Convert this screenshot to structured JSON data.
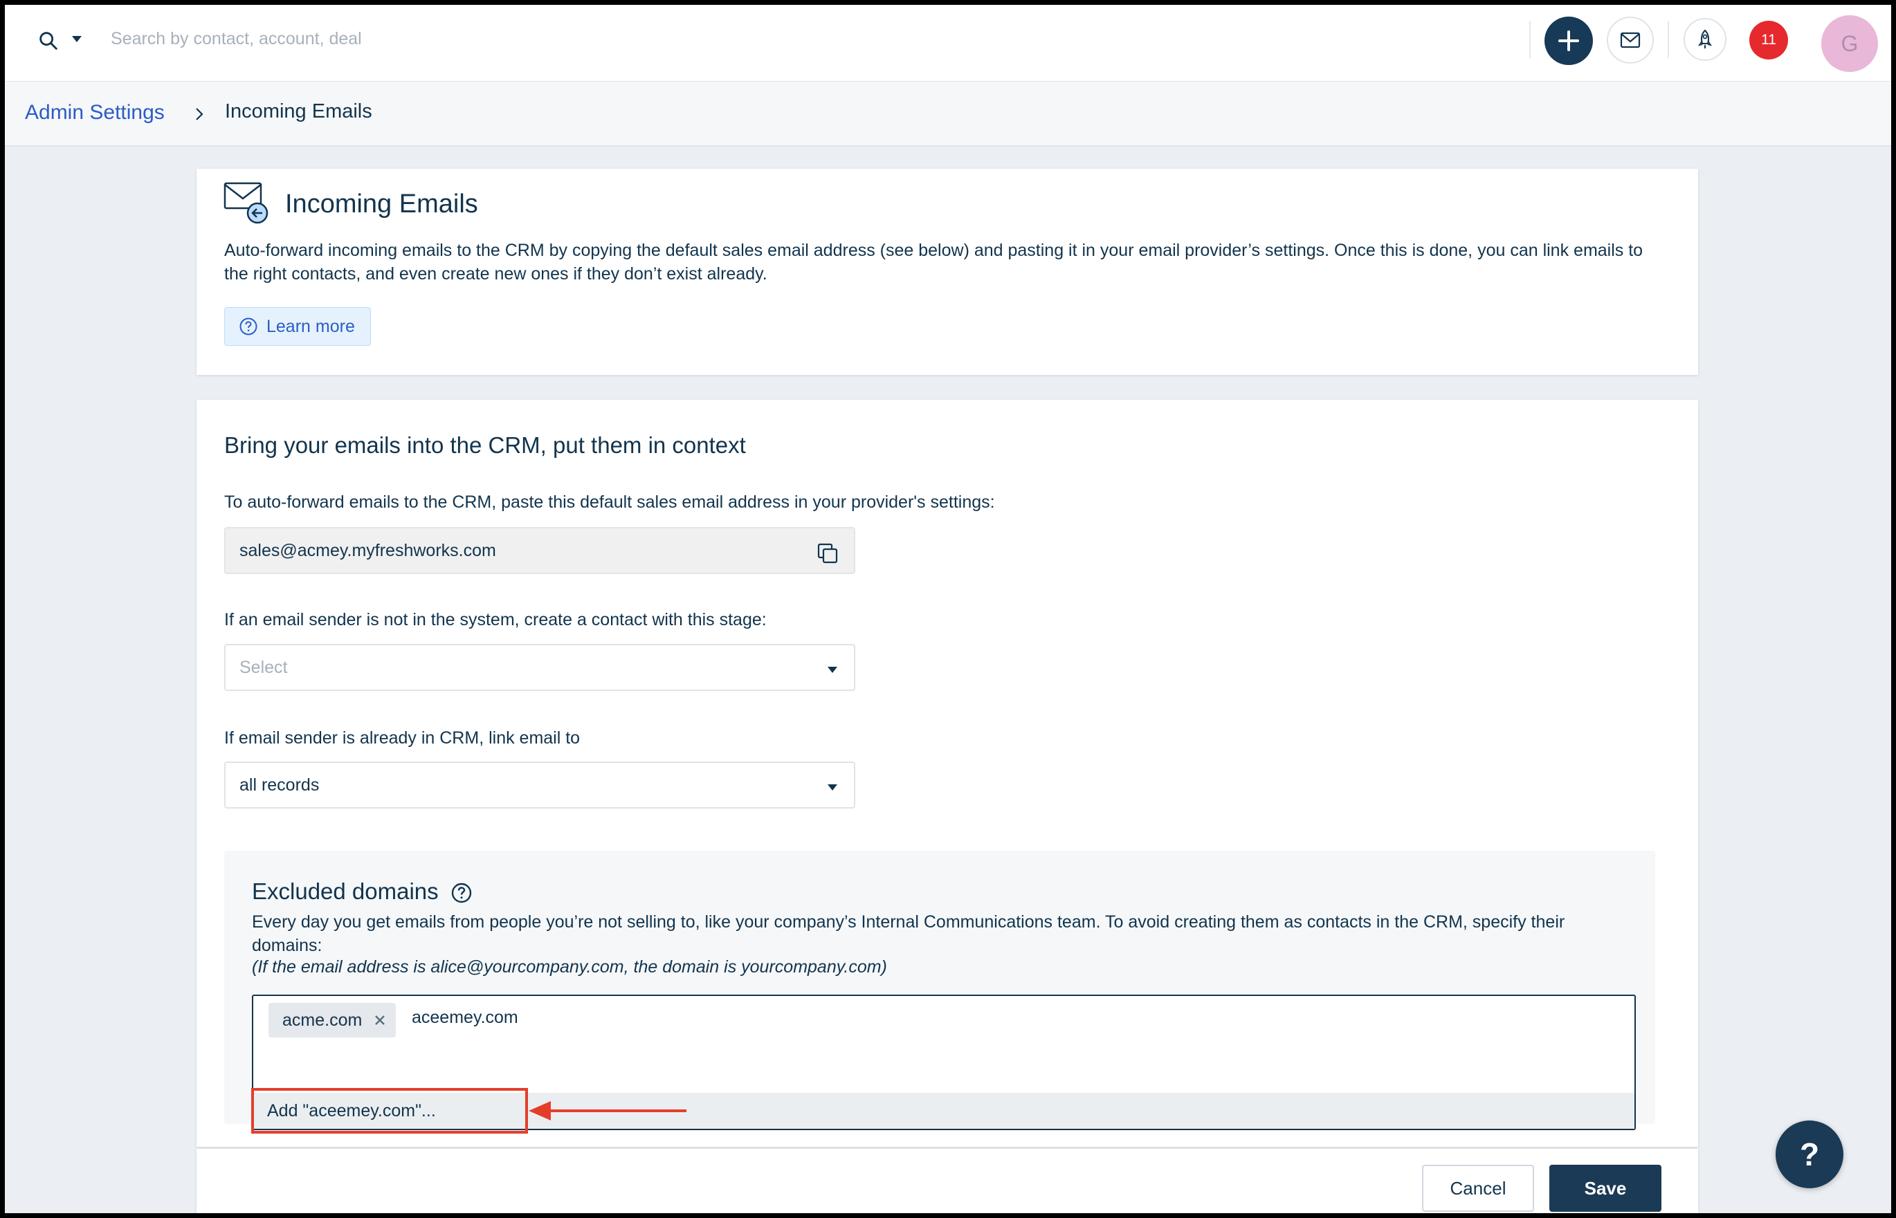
{
  "topbar": {
    "search_placeholder": "Search by contact, account, deal",
    "icons": [
      "search-icon",
      "chevron-down-icon",
      "plus-icon",
      "mail-icon",
      "rocket-icon"
    ],
    "notification_count": "11",
    "avatar_initial": "G"
  },
  "breadcrumb": {
    "parent": "Admin Settings",
    "current": "Incoming Emails"
  },
  "intro": {
    "title": "Incoming Emails",
    "description": "Auto-forward incoming emails to the CRM by copying the default sales email address (see below) and pasting it in your email provider’s settings. Once this is done, you can link emails to the right contacts, and even create new ones if they don’t exist already.",
    "learn_more": "Learn more"
  },
  "settings": {
    "section_title": "Bring your emails into the CRM, put them in context",
    "forward_label": "To auto-forward emails to the CRM, paste this default sales email address in your provider's settings:",
    "forward_email": "sales@acmey.myfreshworks.com",
    "stage_label": "If an email sender is not in the system, create a contact with this stage:",
    "stage_placeholder": "Select",
    "link_label": "If email sender is already in CRM, link email to",
    "link_value": "all records"
  },
  "excluded": {
    "title": "Excluded domains",
    "description": "Every day you get emails from people you’re not selling to, like your company’s Internal Communications team. To avoid creating them as contacts in the CRM, specify their domains:",
    "note": "(If the email address is alice@yourcompany.com, the domain is yourcompany.com)",
    "tags": [
      "acme.com"
    ],
    "typed_value": "aceemey.com",
    "add_option": "Add \"aceemey.com\"..."
  },
  "footer": {
    "cancel": "Cancel",
    "save": "Save"
  },
  "help_fab": "?",
  "colors": {
    "accent": "#2c5cc5",
    "primary_dark": "#1b3a55",
    "highlight": "#e43e2b",
    "badge": "#e6292c"
  }
}
